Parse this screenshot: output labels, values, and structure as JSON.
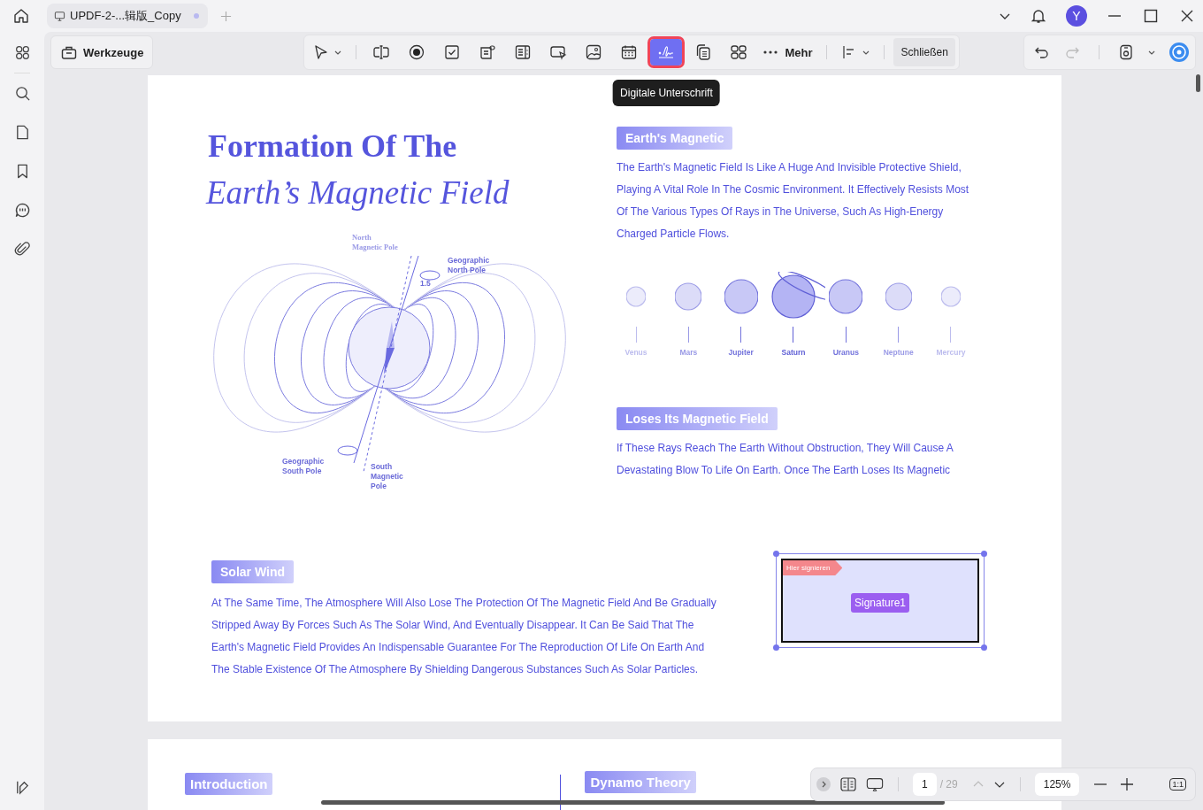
{
  "tab": {
    "title": "UPDF-2-...辑版_Copy",
    "unsaved": true
  },
  "avatar": "Y",
  "tools_button": "Werkzeuge",
  "toolbar": {
    "tools": [
      {
        "kind": "pointer",
        "selected": false
      },
      {
        "kind": "textfield",
        "selected": false
      },
      {
        "kind": "radio",
        "selected": false
      },
      {
        "kind": "checkbox",
        "selected": false
      },
      {
        "kind": "combo",
        "selected": false
      },
      {
        "kind": "listbox",
        "selected": false
      },
      {
        "kind": "buttonfield",
        "selected": false
      },
      {
        "kind": "image",
        "selected": false
      },
      {
        "kind": "date",
        "selected": false
      },
      {
        "kind": "signature",
        "selected": true
      },
      {
        "kind": "copy",
        "selected": false
      },
      {
        "kind": "grid",
        "selected": false
      }
    ],
    "tooltip": "Digitale Unterschrift",
    "more": "Mehr",
    "close": "Schließen"
  },
  "page": {
    "title_line1": "Formation Of The",
    "title_line2": "Earth’s Magnetic Field",
    "diagram_labels": [
      {
        "kind": "north_magnetic",
        "lines": [
          "North",
          "Magnetic Pole"
        ]
      },
      {
        "kind": "north_geographic",
        "lines": [
          "Geographic",
          "North Pole"
        ]
      },
      {
        "kind": "angle",
        "lines": [
          "1.5"
        ]
      },
      {
        "kind": "south_geographic",
        "lines": [
          "Geographic",
          "South Pole"
        ]
      },
      {
        "kind": "south_magnetic",
        "lines": [
          "South",
          "Magnetic",
          "Pole"
        ]
      }
    ],
    "magnetic": {
      "heading": "Earth's Magnetic",
      "text": "The Earth's Magnetic Field Is Like A Huge And Invisible Protective Shield, Playing A Vital Role In The Cosmic Environment. It Effectively Resists Most Of The Various Types Of Rays in The Universe, Such As High-Energy Charged Particle Flows."
    },
    "planets": [
      {
        "name": "Venus",
        "ringed": false
      },
      {
        "name": "Mars",
        "ringed": false
      },
      {
        "name": "Jupiter",
        "ringed": false
      },
      {
        "name": "Saturn",
        "ringed": true
      },
      {
        "name": "Uranus",
        "ringed": false
      },
      {
        "name": "Neptune",
        "ringed": false
      },
      {
        "name": "Mercury",
        "ringed": false
      }
    ],
    "loses": {
      "heading": "Loses Its Magnetic Field",
      "text": "If These Rays Reach The Earth Without Obstruction, They Will Cause A Devastating Blow To Life On Earth. Once The Earth Loses Its Magnetic"
    },
    "solar": {
      "heading": "Solar Wind",
      "text": "At The Same Time, The Atmosphere Will Also Lose The Protection Of The Magnetic Field And Be Gradually Stripped Away By Forces Such As The Solar Wind, And Eventually Disappear. It Can Be Said That The Earth's Magnetic Field Provides An Indispensable Guarantee For The Reproduction Of Life On Earth And The Stable Existence Of The Atmosphere By Shielding Dangerous Substances Such As Solar Particles."
    },
    "signature": {
      "tag": "Hier signieren",
      "name": "Signature1",
      "selected": true
    }
  },
  "page2": {
    "left": "Introduction",
    "right": "Dynamo Theory"
  },
  "bottom_bar": {
    "page": "1",
    "total": "/ 29",
    "zoom": "125%",
    "actual_size": "1:1"
  }
}
